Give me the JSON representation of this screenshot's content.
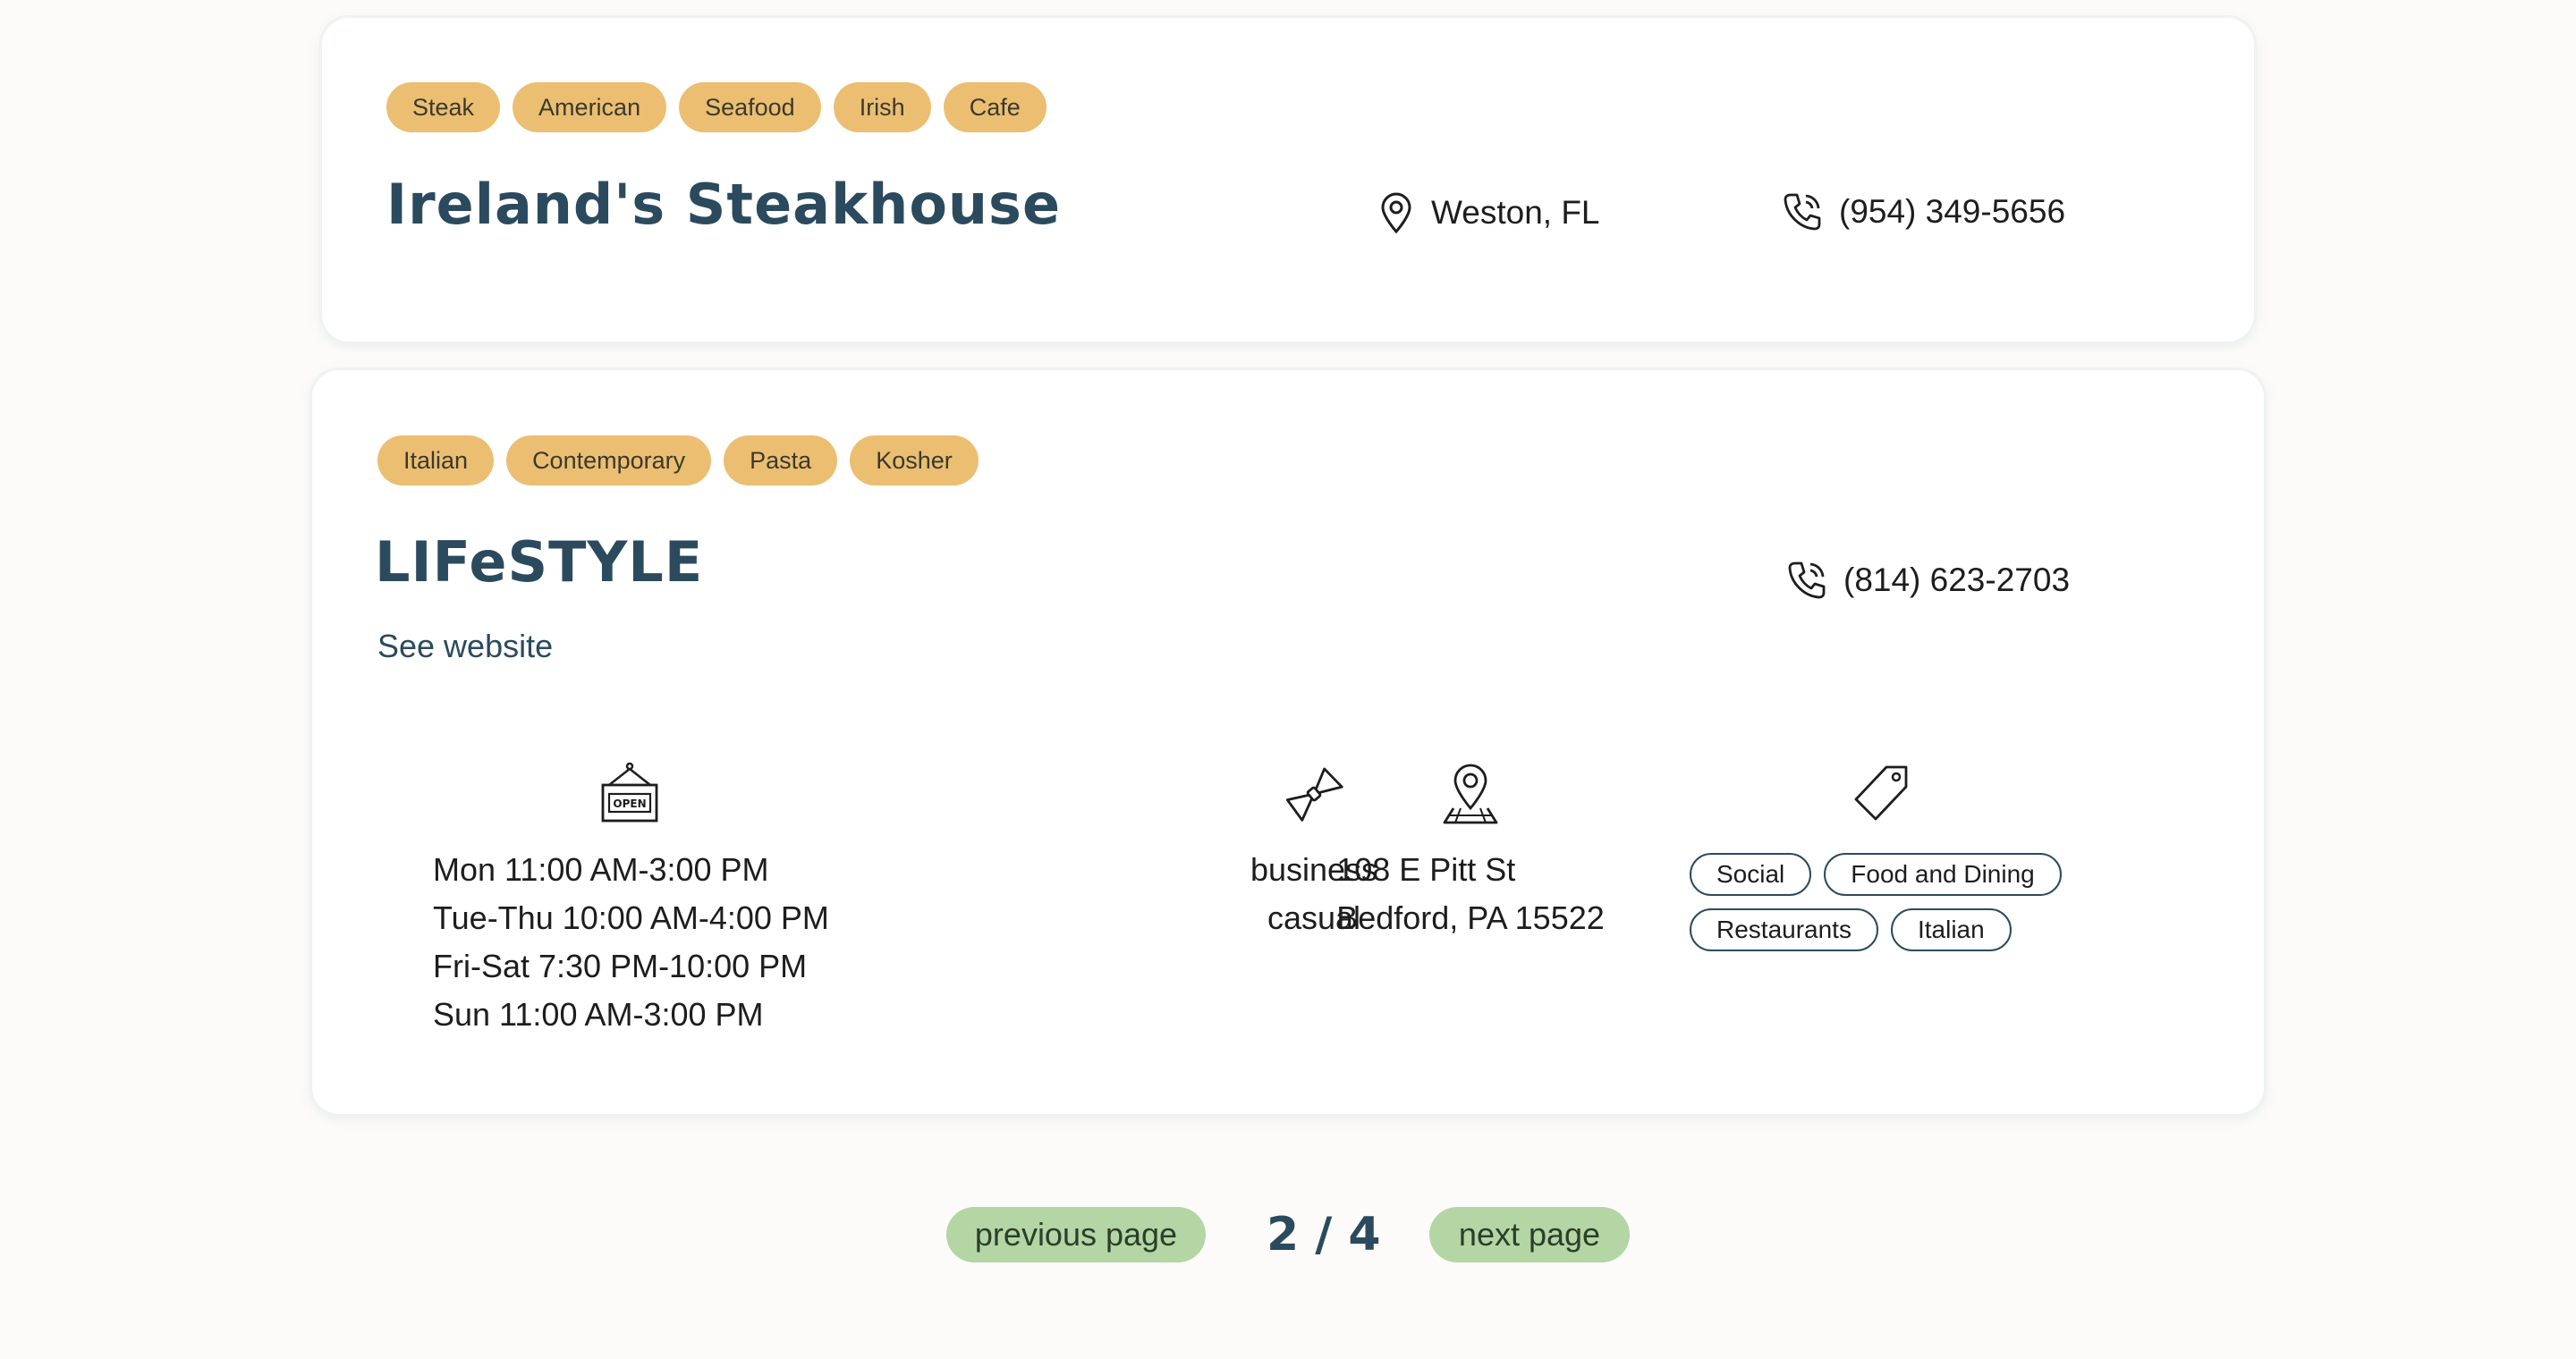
{
  "restaurants": [
    {
      "tags": [
        "Steak",
        "American",
        "Seafood",
        "Irish",
        "Cafe"
      ],
      "name": "Ireland's Steakhouse",
      "location": "Weston, FL",
      "phone": "(954) 349-5656"
    },
    {
      "tags": [
        "Italian",
        "Contemporary",
        "Pasta",
        "Kosher"
      ],
      "name": "LIFeSTYLE",
      "website_label": "See website",
      "phone": "(814) 623-2703",
      "hours": [
        "Mon 11:00 AM-3:00 PM",
        "Tue-Thu 10:00 AM-4:00 PM",
        "Fri-Sat 7:30 PM-10:00 PM",
        "Sun 11:00 AM-3:00 PM"
      ],
      "dress_code": [
        "business",
        "casual"
      ],
      "address": [
        "108 E Pitt St",
        "Bedford, PA 15522"
      ],
      "categories": [
        "Social",
        "Food and Dining",
        "Restaurants",
        "Italian"
      ],
      "icons": {
        "hours": "open-sign-icon",
        "dress_code": "bow-tie-icon",
        "address": "map-pin-icon",
        "categories": "price-tag-icon"
      }
    }
  ],
  "pagination": {
    "previous_label": "previous page",
    "page_indicator": "2 / 4",
    "next_label": "next page"
  },
  "colors": {
    "tag_bg": "#ecbe72",
    "title": "#2b4a5e",
    "pager_button_bg": "#b3d6a4",
    "page_bg": "#fcfbf9"
  }
}
